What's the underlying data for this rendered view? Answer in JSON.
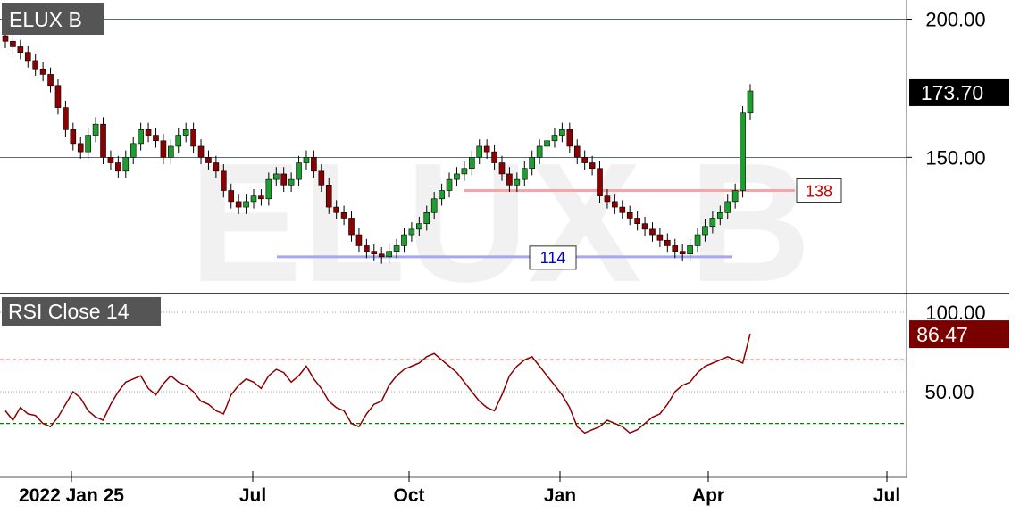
{
  "chart_data": [
    {
      "type": "candlestick",
      "title": "ELUX B",
      "x_ticks": [
        "2022 Jan 25",
        "Jul",
        "Oct",
        "Jan",
        "Apr",
        "Jul"
      ],
      "y_ticks": [
        "200.00",
        "150.00"
      ],
      "ylim": [
        102,
        205
      ],
      "last_price_label": "173.70",
      "last_price": 173.7,
      "lines": [
        {
          "label": "138",
          "value": 138,
          "color": "#f4a6a6",
          "x_start": "Nov 2022",
          "x_end": "Jun 2023"
        },
        {
          "label": "114",
          "value": 114,
          "color": "#a6a6f4",
          "x_start": "Jun 2022",
          "x_end": "Apr 2023"
        }
      ],
      "closes_description": "weekly candles",
      "closes": [
        192,
        190,
        188,
        185,
        182,
        180,
        176,
        168,
        160,
        155,
        152,
        158,
        162,
        150,
        148,
        145,
        150,
        155,
        160,
        158,
        156,
        150,
        154,
        158,
        160,
        154,
        150,
        148,
        145,
        138,
        134,
        132,
        134,
        136,
        135,
        142,
        144,
        140,
        142,
        148,
        150,
        145,
        140,
        132,
        130,
        128,
        122,
        118,
        116,
        115,
        114,
        116,
        118,
        122,
        124,
        126,
        130,
        135,
        138,
        142,
        144,
        146,
        150,
        154,
        152,
        148,
        144,
        140,
        142,
        146,
        150,
        154,
        156,
        158,
        160,
        154,
        150,
        148,
        146,
        136,
        134,
        132,
        130,
        128,
        126,
        124,
        122,
        120,
        118,
        116,
        115,
        118,
        122,
        125,
        128,
        130,
        134,
        138,
        166,
        174
      ],
      "colors": {
        "up": "#1e9e2e",
        "down": "#8b0000",
        "wick": "#000000"
      }
    },
    {
      "type": "line",
      "title": "RSI Close 14",
      "y_ticks": [
        "100.00",
        "50.00"
      ],
      "ylim": [
        0,
        100
      ],
      "last_value_label": "86.47",
      "last_value": 86.47,
      "overbought": 70,
      "oversold": 30,
      "values": [
        38,
        32,
        40,
        36,
        35,
        30,
        28,
        34,
        42,
        50,
        46,
        38,
        34,
        32,
        42,
        50,
        56,
        58,
        60,
        52,
        48,
        55,
        60,
        56,
        54,
        50,
        44,
        42,
        38,
        36,
        48,
        54,
        58,
        56,
        52,
        60,
        64,
        62,
        56,
        60,
        66,
        58,
        52,
        44,
        40,
        38,
        30,
        28,
        36,
        42,
        44,
        54,
        60,
        64,
        66,
        68,
        72,
        74,
        70,
        66,
        62,
        56,
        50,
        44,
        40,
        38,
        48,
        60,
        66,
        70,
        72,
        66,
        60,
        54,
        48,
        40,
        28,
        24,
        26,
        28,
        32,
        30,
        28,
        24,
        26,
        30,
        34,
        36,
        42,
        50,
        54,
        56,
        62,
        66,
        68,
        70,
        72,
        70,
        68,
        86.47
      ],
      "colors": {
        "line": "#8b0000",
        "overbought": "#cc0000",
        "oversold": "#008000"
      }
    }
  ]
}
